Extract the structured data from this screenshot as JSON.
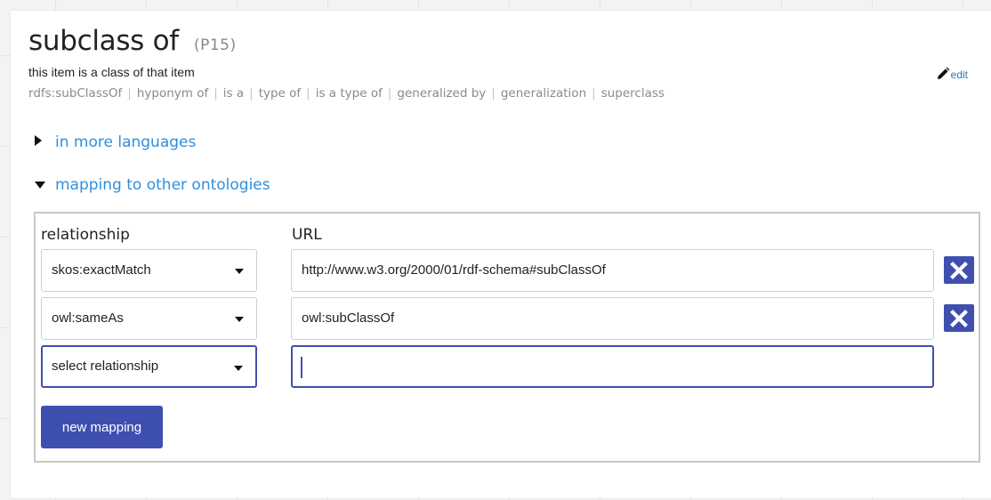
{
  "property": {
    "title": "subclass of",
    "id": "(P15)",
    "description": "this item is a class of that item",
    "aliases": [
      "rdfs:subClassOf",
      "hyponym of",
      "is a",
      "type of",
      "is a type of",
      "generalized by",
      "generalization",
      "superclass"
    ],
    "edit_label": "edit",
    "edit_icon": "pencil-icon"
  },
  "sections": {
    "languages_label": "in more languages",
    "mapping_label": "mapping to other ontologies"
  },
  "mapping": {
    "col_relationship": "relationship",
    "col_url": "URL",
    "rows": [
      {
        "relationship": "skos:exactMatch",
        "url": "http://www.w3.org/2000/01/rdf-schema#subClassOf"
      },
      {
        "relationship": "owl:sameAs",
        "url": "owl:subClassOf"
      },
      {
        "relationship": "select relationship",
        "url": ""
      }
    ],
    "new_mapping_label": "new mapping",
    "delete_icon": "close-icon"
  },
  "colors": {
    "accent": "#3f4fb0",
    "link": "#2e8fe0",
    "muted": "#8a8a8a"
  }
}
